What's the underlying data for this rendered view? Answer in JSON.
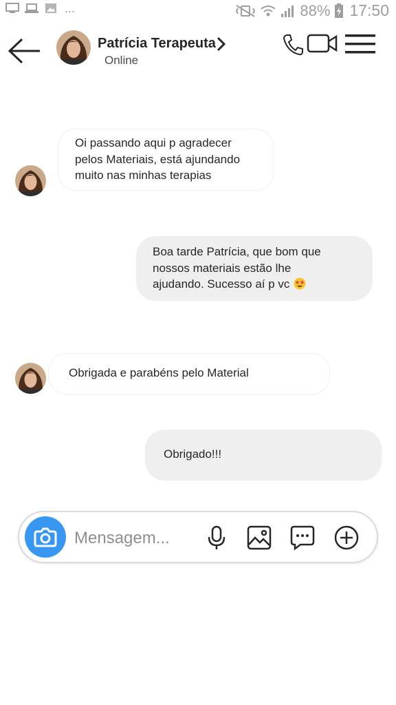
{
  "status_bar": {
    "battery": "88%",
    "time": "17:50",
    "left_icons": [
      "monitor-icon",
      "laptop-icon",
      "image-icon"
    ],
    "right_icons": [
      "vibrate-icon",
      "wifi-icon",
      "signal-icon",
      "battery-icon"
    ]
  },
  "header": {
    "name": "Patrícia Terapeuta",
    "status": "Online",
    "icons": [
      "back-arrow-icon",
      "chevron-right-icon",
      "phone-icon",
      "video-icon",
      "menu-icon"
    ]
  },
  "messages": [
    {
      "from": "contact",
      "lines": [
        "Oi passando aqui p agradecer",
        "pelos Materiais, está ajundando",
        "muito nas minhas terapias"
      ]
    },
    {
      "from": "me",
      "lines": [
        "Boa tarde Patrícia, que bom que",
        "nossos materiais estão lhe",
        "ajudando. Sucesso aí p vc"
      ],
      "emoji": "star-struck-emoji"
    },
    {
      "from": "contact",
      "lines": [
        "Obrigada e parabéns pelo Material"
      ]
    },
    {
      "from": "me",
      "lines": [
        "Obrigado!!!"
      ]
    }
  ],
  "composer": {
    "placeholder": "Mensagem...",
    "icons": [
      "camera-icon",
      "microphone-icon",
      "gallery-icon",
      "sticker-icon",
      "plus-circle-icon"
    ]
  },
  "colors": {
    "accent_blue": "#3897f0",
    "bubble_out": "#efefef",
    "bubble_in_border": "#efefef",
    "text": "#262626",
    "status_gray": "#9e9e9e"
  }
}
